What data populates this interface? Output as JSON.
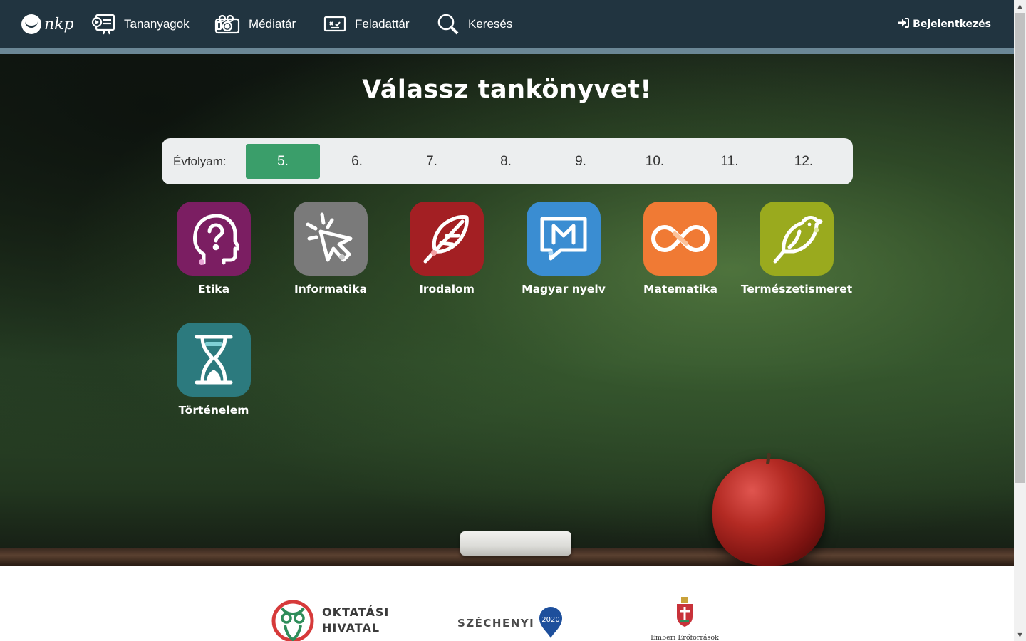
{
  "nav": {
    "logo_text": "nkp",
    "items": [
      {
        "label": "Tananyagok",
        "icon": "presentation-icon"
      },
      {
        "label": "Médiatár",
        "icon": "camera-icon"
      },
      {
        "label": "Feladattár",
        "icon": "task-board-icon"
      },
      {
        "label": "Keresés",
        "icon": "search-icon"
      }
    ],
    "login_label": "Bejelentkezés"
  },
  "hero": {
    "title": "Válassz tankönyvet!",
    "grade_label": "Évfolyam:",
    "grades": [
      "5.",
      "6.",
      "7.",
      "8.",
      "9.",
      "10.",
      "11.",
      "12."
    ],
    "selected_grade": "5.",
    "subjects": [
      {
        "label": "Etika",
        "color": "#7b1e62",
        "icon": "head-question-icon"
      },
      {
        "label": "Informatika",
        "color": "#7a7a7a",
        "icon": "cursor-click-icon"
      },
      {
        "label": "Irodalom",
        "color": "#a31f23",
        "icon": "feather-quill-icon"
      },
      {
        "label": "Magyar nyelv",
        "color": "#3a8dd2",
        "icon": "speech-bubble-m-icon"
      },
      {
        "label": "Matematika",
        "color": "#f07a34",
        "icon": "infinity-icon"
      },
      {
        "label": "Természetismeret",
        "color": "#9aaa1e",
        "icon": "bird-icon"
      },
      {
        "label": "Történelem",
        "color": "#2c7a7e",
        "icon": "hourglass-icon"
      }
    ]
  },
  "footer": {
    "oktatasi_line1": "OKTATÁSI",
    "oktatasi_line2": "HIVATAL",
    "szechenyi": "SZÉCHENYI",
    "szechenyi_badge": "2020",
    "emberi": "Emberi Erőforrások"
  },
  "colors": {
    "nav_bg": "#213440",
    "accent_green": "#3a9e6a"
  }
}
